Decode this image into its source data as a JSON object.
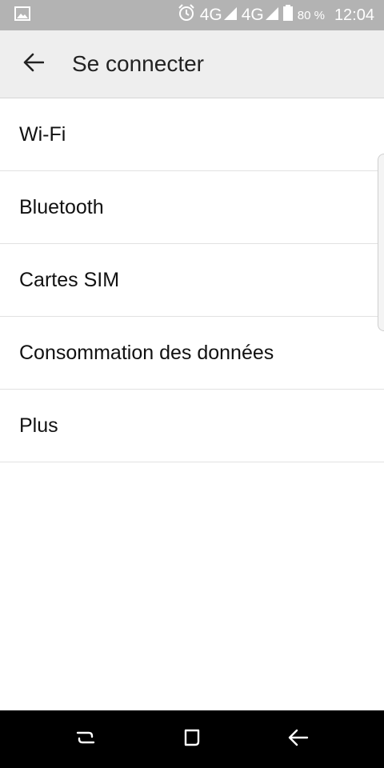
{
  "status_bar": {
    "network_1": "4G",
    "network_2": "4G",
    "battery": "80 %",
    "time": "12:04",
    "icons": [
      "image-icon",
      "alarm-icon",
      "signal-icon",
      "signal-icon",
      "battery-icon"
    ]
  },
  "toolbar": {
    "title": "Se connecter",
    "back_icon": "arrow-back-icon"
  },
  "list": {
    "items": [
      {
        "label": "Wi-Fi"
      },
      {
        "label": "Bluetooth"
      },
      {
        "label": "Cartes SIM"
      },
      {
        "label": "Consommation des données"
      },
      {
        "label": "Plus"
      }
    ]
  },
  "nav_bar": {
    "buttons": [
      "recent-apps-icon",
      "home-icon",
      "back-icon"
    ]
  },
  "colors": {
    "status_bar_bg": "#b3b3b3",
    "toolbar_bg": "#eeeeee",
    "nav_bar_bg": "#000000"
  }
}
